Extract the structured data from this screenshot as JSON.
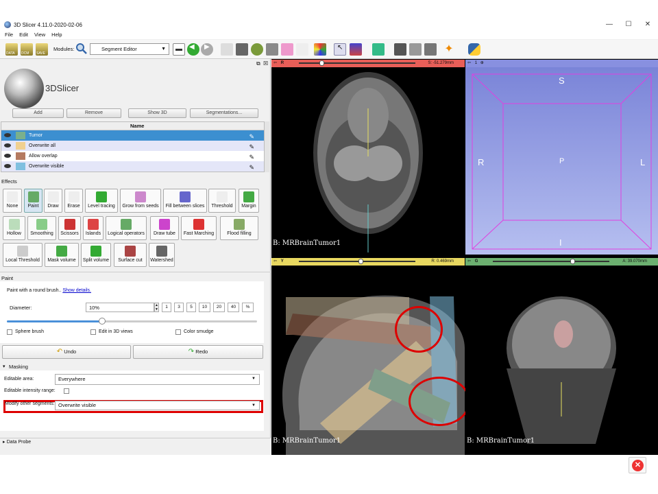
{
  "window": {
    "title": "3D Slicer 4.11.0-2020-02-06",
    "controls": [
      "—",
      "☐",
      "✕"
    ]
  },
  "menu": [
    "File",
    "Edit",
    "View",
    "Help"
  ],
  "toolbar": {
    "modules_label": "Modules:",
    "module": "Segment Editor",
    "data_btn": "DATA",
    "dcm_btn": "DCM",
    "save_btn": "SAVE"
  },
  "logo": {
    "text": "3DSlicer"
  },
  "segment_buttons": [
    "Add",
    "Remove",
    "Show 3D",
    "Segmentations..."
  ],
  "seg_table": {
    "header": "Name",
    "rows": [
      {
        "name": "Tumor",
        "color": "#7ab08c"
      },
      {
        "name": "Overwrite all",
        "color": "#f0d090"
      },
      {
        "name": "Allow overlap",
        "color": "#b57a60"
      },
      {
        "name": "Overwrite visible",
        "color": "#80c0e0"
      }
    ]
  },
  "effects": {
    "label": "Effects",
    "buttons": [
      "None",
      "Paint",
      "Draw",
      "Erase",
      "Level tracing",
      "Grow from seeds",
      "Fill between slices",
      "Threshold",
      "Margin",
      "Hollow",
      "Smoothing",
      "Scissors",
      "Islands",
      "Logical operators",
      "Draw tube",
      "Fast Marching",
      "Flood filling",
      "Local Threshold",
      "Mask volume",
      "Split volume",
      "Surface cut",
      "Watershed"
    ]
  },
  "paint": {
    "section": "Paint",
    "description": "Paint with a round brush.. ",
    "show_details": "Show details.",
    "diameter_label": "Diameter:",
    "diameter_value": "10%",
    "slider_fraction": 0.38,
    "size_buttons": [
      "1",
      "3",
      "5",
      "10",
      "20",
      "40",
      "%"
    ],
    "sphere_brush": "Sphere brush",
    "edit_3d": "Edit in 3D views",
    "color_smudge": "Color smudge"
  },
  "undo": "Undo",
  "redo": "Redo",
  "masking": {
    "section": "Masking",
    "editable_area_label": "Editable area:",
    "editable_area": "Everywhere",
    "intensity_label": "Editable intensity range:",
    "modify_label": "Modify other segments:",
    "modify_value": "Overwrite visible"
  },
  "data_probe": "Data Probe",
  "views": {
    "red": {
      "id": "R",
      "offset": "S: -51.279mm",
      "caption": "B: MRBrainTumor1",
      "color": "#e85e58"
    },
    "threed": {
      "id": "1",
      "labels": [
        "S",
        "R",
        "P",
        "L",
        "I"
      ],
      "color": "#8890e0"
    },
    "yellow": {
      "id": "Y",
      "offset": "R: 0.469mm",
      "caption": "B: MRBrainTumor1",
      "color": "#e8d860"
    },
    "green": {
      "id": "G",
      "offset": "A: 39.070mm",
      "caption": "B: MRBrainTumor1",
      "color": "#6cb070"
    }
  }
}
